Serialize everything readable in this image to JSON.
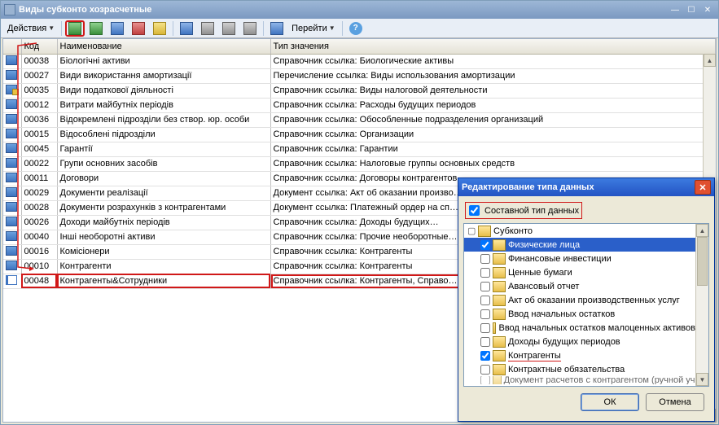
{
  "main_window": {
    "title": "Виды субконто хозрасчетные",
    "toolbar": {
      "actions_label": "Действия",
      "goto_label": "Перейти"
    },
    "columns": {
      "code": "Код",
      "name": "Наименование",
      "type": "Тип значения"
    },
    "rows": [
      {
        "kind": "ref",
        "code": "00038",
        "name": "Біологічні активи",
        "type": "Справочник ссылка: Биологические активы",
        "highlight": false
      },
      {
        "kind": "ref",
        "code": "00027",
        "name": "Види використання амортизації",
        "type": "Перечисление ссылка: Виды использования амортизации",
        "highlight": false
      },
      {
        "kind": "ref-edit",
        "code": "00035",
        "name": "Види податкової діяльності",
        "type": "Справочник ссылка: Виды налоговой деятельности",
        "highlight": false
      },
      {
        "kind": "ref",
        "code": "00012",
        "name": "Витрати майбутніх періодів",
        "type": "Справочник ссылка: Расходы будущих периодов",
        "highlight": false
      },
      {
        "kind": "ref",
        "code": "00036",
        "name": "Відокремлені підрозділи без створ. юр. особи",
        "type": "Справочник ссылка: Обособленные подразделения организаций",
        "highlight": false
      },
      {
        "kind": "ref",
        "code": "00015",
        "name": "Відособлені підрозділи",
        "type": "Справочник ссылка: Организации",
        "highlight": false
      },
      {
        "kind": "ref",
        "code": "00045",
        "name": "Гарантії",
        "type": "Справочник ссылка: Гарантии",
        "highlight": false
      },
      {
        "kind": "ref",
        "code": "00022",
        "name": "Групи основних засобів",
        "type": "Справочник ссылка: Налоговые группы основных средств",
        "highlight": false
      },
      {
        "kind": "ref",
        "code": "00011",
        "name": "Договори",
        "type": "Справочник ссылка: Договоры контрагентов",
        "highlight": false
      },
      {
        "kind": "ref",
        "code": "00029",
        "name": "Документи реалізації",
        "type": "Документ ссылка: Акт об оказании произво…",
        "highlight": false
      },
      {
        "kind": "ref",
        "code": "00028",
        "name": "Документи розрахунків з контрагентами",
        "type": "Документ ссылка: Платежный ордер на сп…",
        "highlight": false
      },
      {
        "kind": "ref",
        "code": "00026",
        "name": "Доходи майбутніх періодів",
        "type": "Справочник ссылка: Доходы будущих…",
        "highlight": false
      },
      {
        "kind": "ref",
        "code": "00040",
        "name": "Інші необоротні активи",
        "type": "Справочник ссылка: Прочие необоротные…",
        "highlight": false
      },
      {
        "kind": "ref",
        "code": "00016",
        "name": "Комісіонери",
        "type": "Справочник ссылка: Контрагенты",
        "highlight": false
      },
      {
        "kind": "ref",
        "code": "00010",
        "name": "Контрагенти",
        "type": "Справочник ссылка: Контрагенты",
        "highlight": false
      },
      {
        "kind": "doc",
        "code": "00048",
        "name": "Контрагенты&Сотрудники",
        "type": "Справочник ссылка: Контрагенты, Справо…",
        "highlight": true
      }
    ]
  },
  "dialog": {
    "title": "Редактирование типа данных",
    "composite_label": "Составной тип данных",
    "composite_checked": true,
    "items": [
      {
        "label": "Физические лица",
        "checked": true,
        "selected": true
      },
      {
        "label": "Финансовые инвестиции",
        "checked": false
      },
      {
        "label": "Ценные бумаги",
        "checked": false
      },
      {
        "label": "Авансовый отчет",
        "checked": false
      },
      {
        "label": "Акт об оказании производственных услуг",
        "checked": false
      },
      {
        "label": "Ввод начальных остатков",
        "checked": false
      },
      {
        "label": "Ввод начальных остатков малоценных активов …",
        "checked": false
      },
      {
        "label": "Доходы будущих периодов",
        "checked": false
      },
      {
        "label": "Контрагенты",
        "checked": true,
        "underline": true
      },
      {
        "label": "Контрактные обязательства",
        "checked": false
      },
      {
        "label": "Документ расчетов с контрагентом (ручной учет)",
        "checked": false,
        "cut": true
      }
    ],
    "scroll_parent": "Субконто",
    "ok_label": "ОК",
    "cancel_label": "Отмена"
  }
}
